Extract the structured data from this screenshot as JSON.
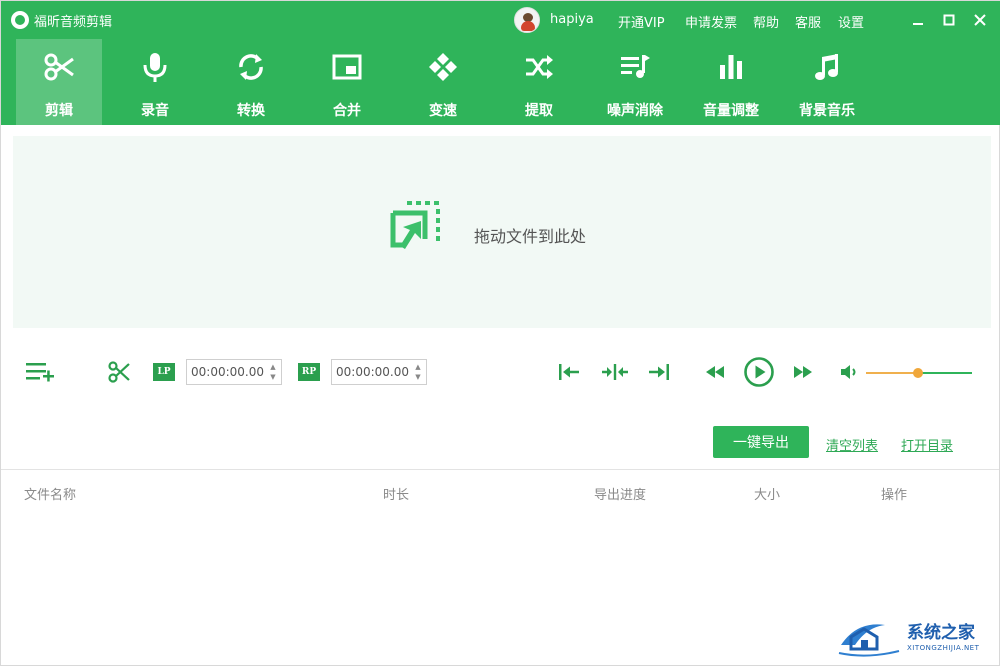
{
  "titlebar": {
    "app_title": "福昕音频剪辑",
    "username": "hapiya",
    "menu": [
      "开通VIP",
      "申请发票",
      "帮助",
      "客服",
      "设置"
    ],
    "window_controls": [
      "minimize-icon",
      "maximize-icon",
      "close-icon"
    ]
  },
  "toolbar": {
    "items": [
      {
        "label": "剪辑",
        "icon": "scissors-icon",
        "active": true
      },
      {
        "label": "录音",
        "icon": "microphone-icon",
        "active": false
      },
      {
        "label": "转换",
        "icon": "convert-icon",
        "active": false
      },
      {
        "label": "合并",
        "icon": "merge-icon",
        "active": false
      },
      {
        "label": "变速",
        "icon": "speed-icon",
        "active": false
      },
      {
        "label": "提取",
        "icon": "shuffle-icon",
        "active": false
      },
      {
        "label": "噪声消除",
        "icon": "noise-removal-icon",
        "active": false
      },
      {
        "label": "音量调整",
        "icon": "volume-bars-icon",
        "active": false
      },
      {
        "label": "背景音乐",
        "icon": "music-note-icon",
        "active": false
      }
    ]
  },
  "dropzone": {
    "text": "拖动文件到此处",
    "icon": "drop-file-icon"
  },
  "controls": {
    "lp_tag": "LP",
    "rp_tag": "RP",
    "lp_time": "00:00:00.00",
    "rp_time": "00:00:00.00",
    "volume_level": 0.49
  },
  "actions": {
    "export": "一键导出",
    "clear_list": "清空列表",
    "open_dir": "打开目录"
  },
  "table": {
    "columns": [
      "文件名称",
      "时长",
      "导出进度",
      "大小",
      "操作"
    ],
    "rows": []
  },
  "watermark": {
    "text": "系统之家",
    "sub": "XITONGZHIJIA.NET"
  },
  "colors": {
    "brand_green": "#2fb45a",
    "accent_orange": "#f0a73a"
  }
}
